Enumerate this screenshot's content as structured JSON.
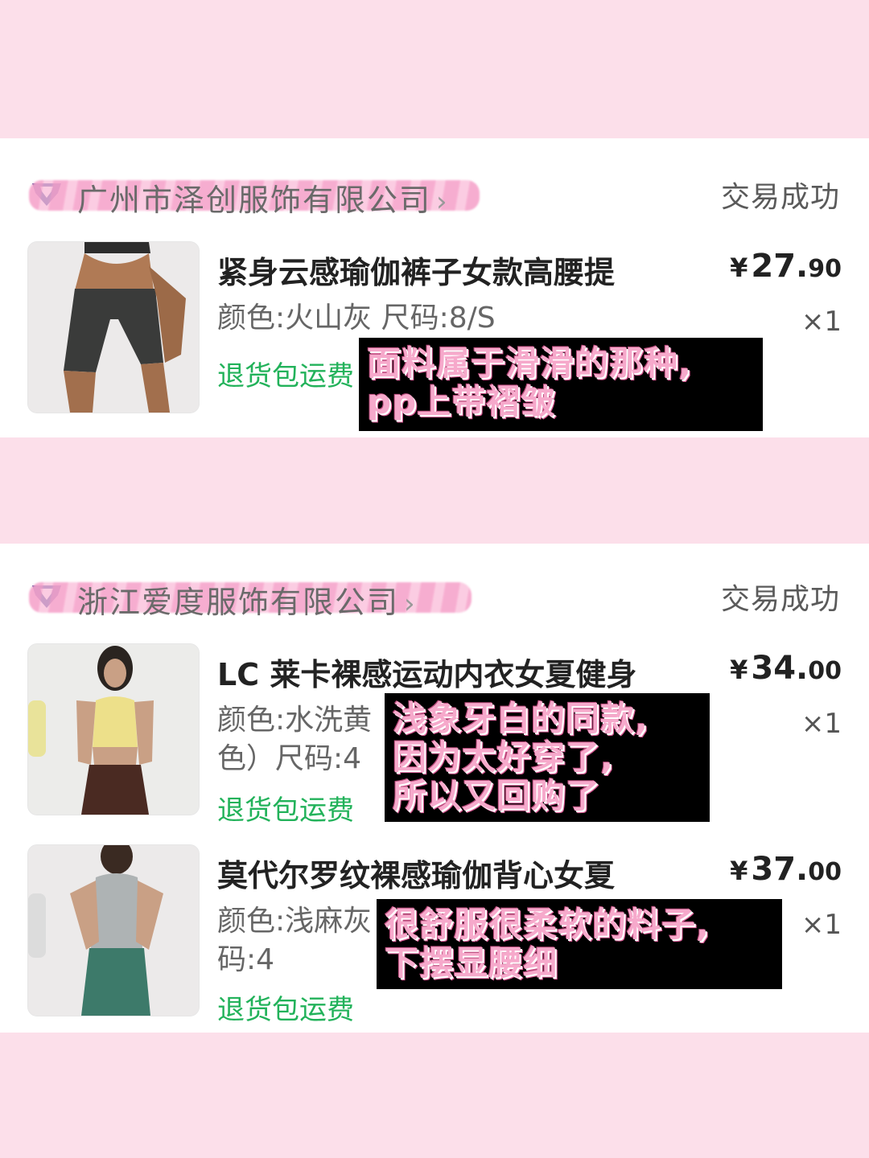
{
  "orders": [
    {
      "store_name": "广州市泽创服饰有限公司",
      "status": "交易成功",
      "items": [
        {
          "title": "紧身云感瑜伽裤子女款高腰提",
          "spec": "颜色:火山灰  尺码:8/S",
          "tag": "退货包运费",
          "price_symbol": "¥",
          "price_int": "27.",
          "price_dec": "90",
          "qty": "×1",
          "note": "面料属于滑滑的那种,\npp上带褶皱"
        }
      ]
    },
    {
      "store_name": "浙江爱度服饰有限公司",
      "status": "交易成功",
      "items": [
        {
          "title": "LC 莱卡裸感运动内衣女夏健身",
          "spec": "颜色:水洗黄\n色）尺码:4",
          "tag": "退货包运费",
          "price_symbol": "¥",
          "price_int": "34.",
          "price_dec": "00",
          "qty": "×1",
          "note": "浅象牙白的同款,\n因为太好穿了,\n所以又回购了"
        },
        {
          "title": "莫代尔罗纹裸感瑜伽背心女夏",
          "spec": "颜色:浅麻灰\n码:4",
          "tag": "退货包运费",
          "price_symbol": "¥",
          "price_int": "37.",
          "price_dec": "00",
          "qty": "×1",
          "note": "很舒服很柔软的料子,\n下摆显腰细"
        }
      ]
    }
  ],
  "icons": {
    "store": "store-badge-icon",
    "chevron": "chevron-right-icon"
  },
  "colors": {
    "background": "#fcdfea",
    "tag_green": "#22b25a",
    "note_text": "#f6a9cb",
    "note_bg": "#000000"
  }
}
